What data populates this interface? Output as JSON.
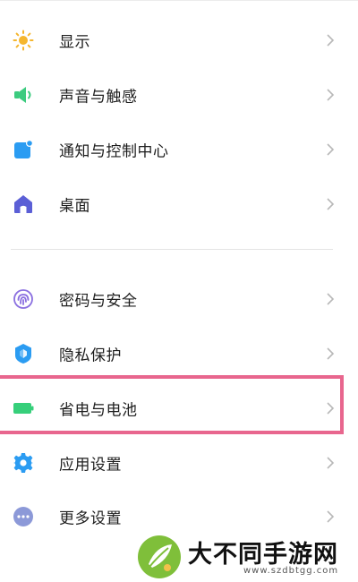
{
  "settings": {
    "items": [
      {
        "label": "显示",
        "icon": "brightness-icon",
        "color": "#f5b62e"
      },
      {
        "label": "声音与触感",
        "icon": "speaker-icon",
        "color": "#3ccb7f"
      },
      {
        "label": "通知与控制中心",
        "icon": "notification-icon",
        "color": "#2b9cf2"
      },
      {
        "label": "桌面",
        "icon": "home-icon",
        "color": "#5b5fd6"
      },
      {
        "label": "密码与安全",
        "icon": "fingerprint-icon",
        "color": "#8a6fe0"
      },
      {
        "label": "隐私保护",
        "icon": "privacy-shield-icon",
        "color": "#2b9cf2"
      },
      {
        "label": "省电与电池",
        "icon": "battery-icon",
        "color": "#36cf7a"
      },
      {
        "label": "应用设置",
        "icon": "gear-icon",
        "color": "#2b9cf2"
      },
      {
        "label": "更多设置",
        "icon": "more-icon",
        "color": "#8c99d8"
      }
    ],
    "highlighted": "省电与电池",
    "highlight_color": "#e8668e"
  },
  "watermark": {
    "title": "大不同手游网",
    "url": "www.szdbtgg.com"
  }
}
